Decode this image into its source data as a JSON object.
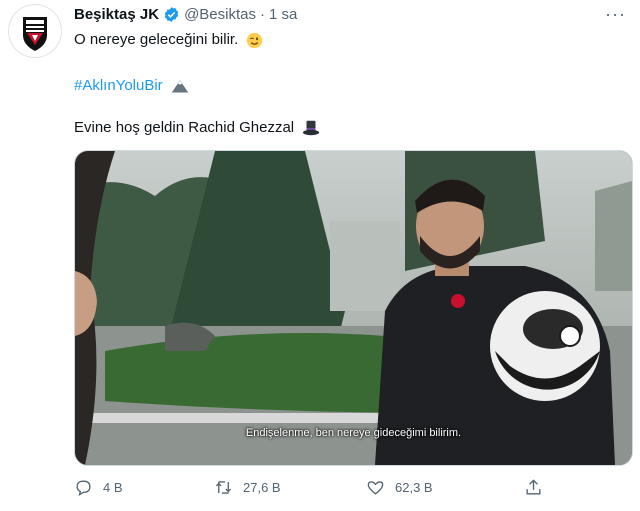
{
  "tweet": {
    "author_name": "Beşiktaş JK",
    "handle": "@Besiktas",
    "separator": "·",
    "time": "1 sa",
    "more_label": "···",
    "line1": "O nereye geleceğini bilir.",
    "hashtag": "#AklınYoluBir",
    "line3": "Evine hoş geldin Rachid Ghezzal",
    "emojis": [
      "winking-face",
      "mountain-snow",
      "top-hat"
    ]
  },
  "media": {
    "subtitle": "Endişelenme, ben nereye gideceğimi bilirim."
  },
  "actions": {
    "reply_count": "4 B",
    "retweet_count": "27,6 B",
    "like_count": "62,3 B"
  },
  "colors": {
    "accent": "#1d9bf0",
    "muted": "#536471",
    "text": "#0f1419"
  }
}
